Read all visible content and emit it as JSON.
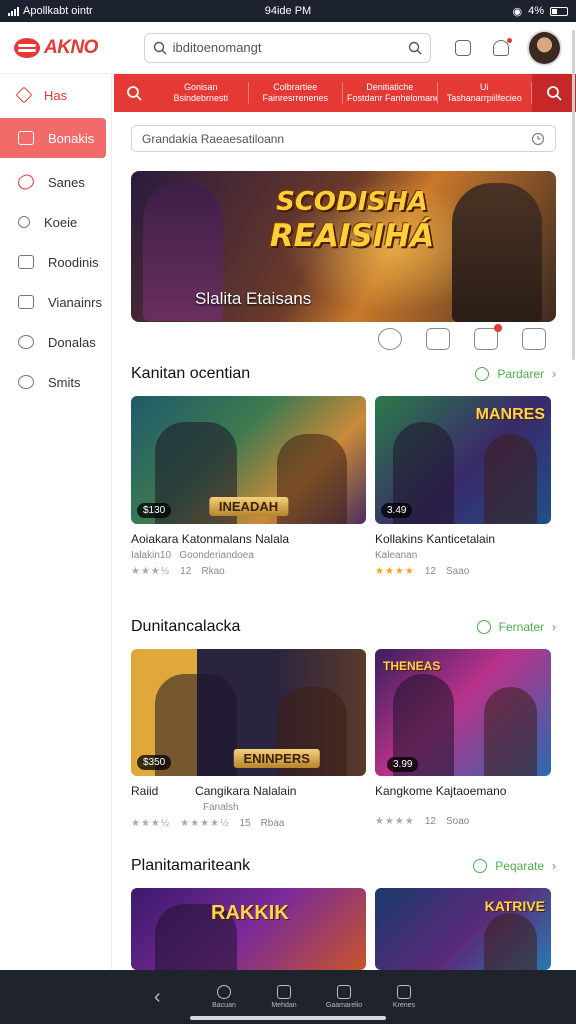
{
  "status": {
    "carrier": "Apollkabt ointr",
    "time": "94ide PM",
    "battery": "4%"
  },
  "header": {
    "logo": "AKNO",
    "search_value": "ibditoenomangt"
  },
  "sidebar": {
    "items": [
      {
        "label": "Has",
        "icon": "home-icon"
      },
      {
        "label": "Bonakis",
        "icon": "library-icon",
        "active": true
      },
      {
        "label": "Sanes",
        "icon": "games-icon"
      },
      {
        "label": "Koeie",
        "icon": "search-icon"
      },
      {
        "label": "Roodinis",
        "icon": "keyboard-icon"
      },
      {
        "label": "Vianainrs",
        "icon": "video-icon"
      },
      {
        "label": "Donalas",
        "icon": "deals-icon"
      },
      {
        "label": "Smits",
        "icon": "stats-icon"
      }
    ]
  },
  "categories": [
    {
      "line1": "Gonisan",
      "line2": "Bsindebrnesti"
    },
    {
      "line1": "Colbrartiee",
      "line2": "Fainresrrenenes"
    },
    {
      "line1": "Denitiatiche",
      "line2": "Fostdanr Fanhelomanetrls"
    },
    {
      "line1": "Ui",
      "line2": "Tashanarrpiilfecieo"
    }
  ],
  "search2": {
    "placeholder": "Grandakia Raeaesatiloann"
  },
  "hero": {
    "title_line1": "SCODISHA",
    "title_line2": "REAISIHÁ",
    "subtitle": "Slalita Etaisans"
  },
  "sections": [
    {
      "title": "Kanitan ocentian",
      "more": "Pardarer",
      "cards": [
        {
          "price": "$130",
          "banner": "INEADAH",
          "name": "Aoiakara Katonmalans Nalala",
          "meta1": "Ialakin10",
          "meta2": "Goonderiandoea",
          "stars": "★★★½",
          "rating": "12",
          "extra": "Rkao"
        },
        {
          "price": "3.49",
          "toplabel": "MANRES",
          "name": "Kollakins Kanticetalain",
          "meta1": "Kaleanan",
          "stars": "★★★★",
          "rating": "12",
          "extra": "Saao"
        }
      ]
    },
    {
      "title": "Dunitancalacka",
      "more": "Fernater",
      "cards": [
        {
          "price": "$350",
          "banner": "ENINPERS",
          "name": "Raiid",
          "name2": "Cangikara Nalalain",
          "meta1": "Fanalsh",
          "stars": "★★★½",
          "stars2": "★★★★½",
          "rating": "15",
          "extra": "Rbaa"
        },
        {
          "price": "3.99",
          "toplabel": "THENEAS",
          "name": "Kangkome Kajtaoemano",
          "stars": "★★★★",
          "rating": "12",
          "extra": "Soao"
        }
      ]
    },
    {
      "title": "Planitamariteank",
      "more": "Peqarate",
      "cards": [
        {
          "toplabel": "RAKKIK"
        },
        {
          "toplabel": "KATRIVE"
        }
      ]
    }
  ],
  "bottom_nav": [
    {
      "label": "Bacuan",
      "icon": "search-icon"
    },
    {
      "label": "Mehdan",
      "icon": "controller-icon"
    },
    {
      "label": "Gaamarelio",
      "icon": "library-icon"
    },
    {
      "label": "Krenes",
      "icon": "store-icon"
    }
  ],
  "colors": {
    "brand_red": "#e53935",
    "accent_green": "#4caf50",
    "nav_dark": "#1f232b"
  }
}
